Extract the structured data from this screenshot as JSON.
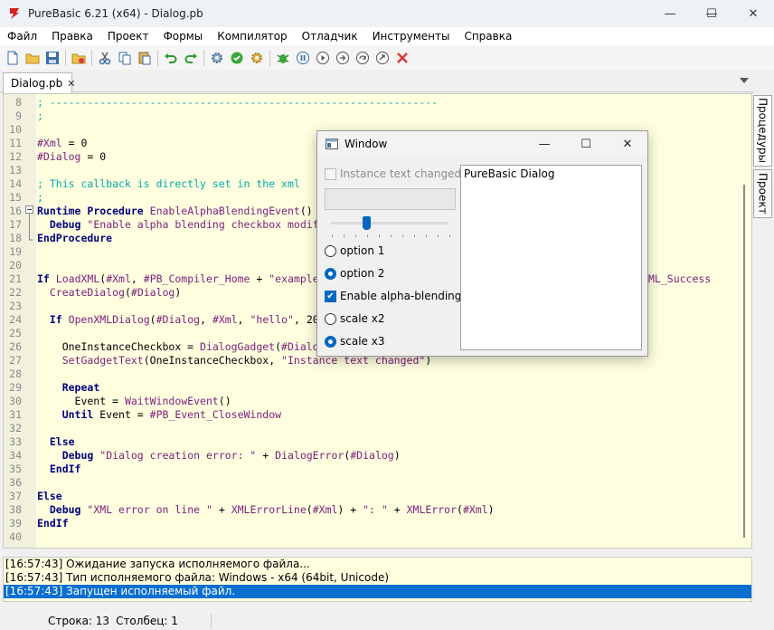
{
  "window": {
    "title": "PureBasic 6.21 (x64) - Dialog.pb",
    "minimize": "—",
    "maximize": "☐",
    "close": "✕"
  },
  "menu": [
    "Файл",
    "Правка",
    "Проект",
    "Формы",
    "Компилятор",
    "Отладчик",
    "Инструменты",
    "Справка"
  ],
  "toolbar_icons": [
    "new-file-icon",
    "open-file-icon",
    "save-icon",
    "close-file-icon",
    "cut-icon",
    "copy-icon",
    "paste-icon",
    "undo-icon",
    "redo-icon",
    "compile-icon",
    "check-syntax-icon",
    "build-icon",
    "debugger-icon",
    "pause-icon",
    "continue-icon",
    "step-icon",
    "step-over-icon",
    "step-out-icon",
    "kill-icon"
  ],
  "tab": {
    "label": "Dialog.pb",
    "close": "✕"
  },
  "side_tabs": [
    "Процедуры",
    "Проект"
  ],
  "code_lines": [
    {
      "n": "8",
      "text": "; --------------------------------------------------------------"
    },
    {
      "n": "9",
      "text": ";"
    },
    {
      "n": "10",
      "text": ""
    },
    {
      "n": "11",
      "text": "#Xml = 0"
    },
    {
      "n": "12",
      "text": "#Dialog = 0"
    },
    {
      "n": "13",
      "text": ""
    },
    {
      "n": "14",
      "text": "; This callback is directly set in the xml"
    },
    {
      "n": "15",
      "text": ";"
    },
    {
      "n": "16",
      "text": "Runtime Procedure EnableAlphaBlendingEvent()"
    },
    {
      "n": "17",
      "text": "  Debug \"Enable alpha blending checkbox modif"
    },
    {
      "n": "18",
      "text": "EndProcedure"
    },
    {
      "n": "19",
      "text": ""
    },
    {
      "n": "20",
      "text": ""
    },
    {
      "n": "21",
      "text": "If LoadXML(#Xml, #PB_Compiler_Home + \"example"
    },
    {
      "n": "22",
      "text": "  CreateDialog(#Dialog)"
    },
    {
      "n": "23",
      "text": ""
    },
    {
      "n": "24",
      "text": "  If OpenXMLDialog(#Dialog, #Xml, \"hello\", 20"
    },
    {
      "n": "25",
      "text": ""
    },
    {
      "n": "26",
      "text": "    OneInstanceCheckbox = DialogGadget(#Dialo"
    },
    {
      "n": "27",
      "text": "    SetGadgetText(OneInstanceCheckbox, \"Instance text changed\")"
    },
    {
      "n": "28",
      "text": ""
    },
    {
      "n": "29",
      "text": "    Repeat"
    },
    {
      "n": "30",
      "text": "      Event = WaitWindowEvent()"
    },
    {
      "n": "31",
      "text": "    Until Event = #PB_Event_CloseWindow"
    },
    {
      "n": "32",
      "text": ""
    },
    {
      "n": "33",
      "text": "  Else"
    },
    {
      "n": "34",
      "text": "    Debug \"Dialog creation error: \" + DialogError(#Dialog)"
    },
    {
      "n": "35",
      "text": "  EndIf"
    },
    {
      "n": "36",
      "text": ""
    },
    {
      "n": "37",
      "text": "Else"
    },
    {
      "n": "38",
      "text": "  Debug \"XML error on line \" + XMLErrorLine(#Xml) + \": \" + XMLError(#Xml)"
    },
    {
      "n": "39",
      "text": "EndIf"
    },
    {
      "n": "40",
      "text": ""
    }
  ],
  "line21_tail": "ML_Success",
  "log": [
    "[16:57:43] Ожидание запуска исполняемого файла...",
    "[16:57:43] Тип исполняемого файла: Windows - x64  (64bit, Unicode)",
    "[16:57:43] Запущен исполняемый файл."
  ],
  "status": {
    "line": "Строка: 13",
    "column": "Столбец: 1"
  },
  "dialog": {
    "title": "Window",
    "checkbox_instance": "Instance text changed",
    "text_area": "PureBasic Dialog",
    "option1": "option 1",
    "option2": "option 2",
    "alpha": "Enable alpha-blending",
    "scale2": "scale x2",
    "scale3": "scale x3",
    "slider_level": 0.3,
    "selected_option": "option 2",
    "selected_scale": "scale x3",
    "alpha_checked": true
  },
  "colors": {
    "editor_bg": "#ffffe0",
    "keyword": "#000080",
    "comment": "#00aaaa",
    "constant": "#7a1e7a",
    "selection": "#0a6fd0",
    "accent": "#0067c0"
  }
}
